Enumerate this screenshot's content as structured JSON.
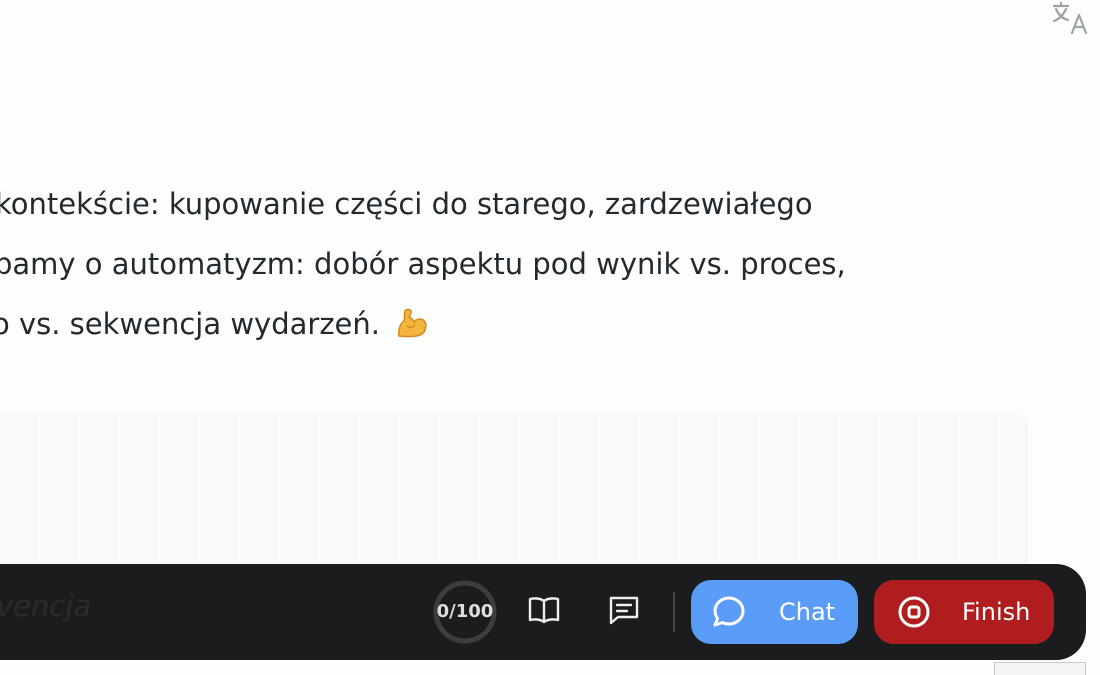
{
  "top_bar": {
    "translate_icon": "translate-icon"
  },
  "content": {
    "line1": "kontekście: kupowanie części do starego, zardzewiałego",
    "line2": "pamy o automatyzm: dobór aspektu pod wynik vs. proces,",
    "line3": "o vs. sekwencja wydarzeń.",
    "emoji": "flexed-biceps-emoji"
  },
  "toolbar": {
    "input_text": "vencja",
    "progress": {
      "label": "0/100",
      "value": 0,
      "max": 100
    },
    "book_icon": "open-book-icon",
    "notes_icon": "notes-icon",
    "chat_label": "Chat",
    "finish_label": "Finish"
  },
  "colors": {
    "chat_button": "#5b9cf8",
    "finish_button": "#b01d1f",
    "toolbar_background": "#1b1c1e",
    "text": "#24292f"
  }
}
